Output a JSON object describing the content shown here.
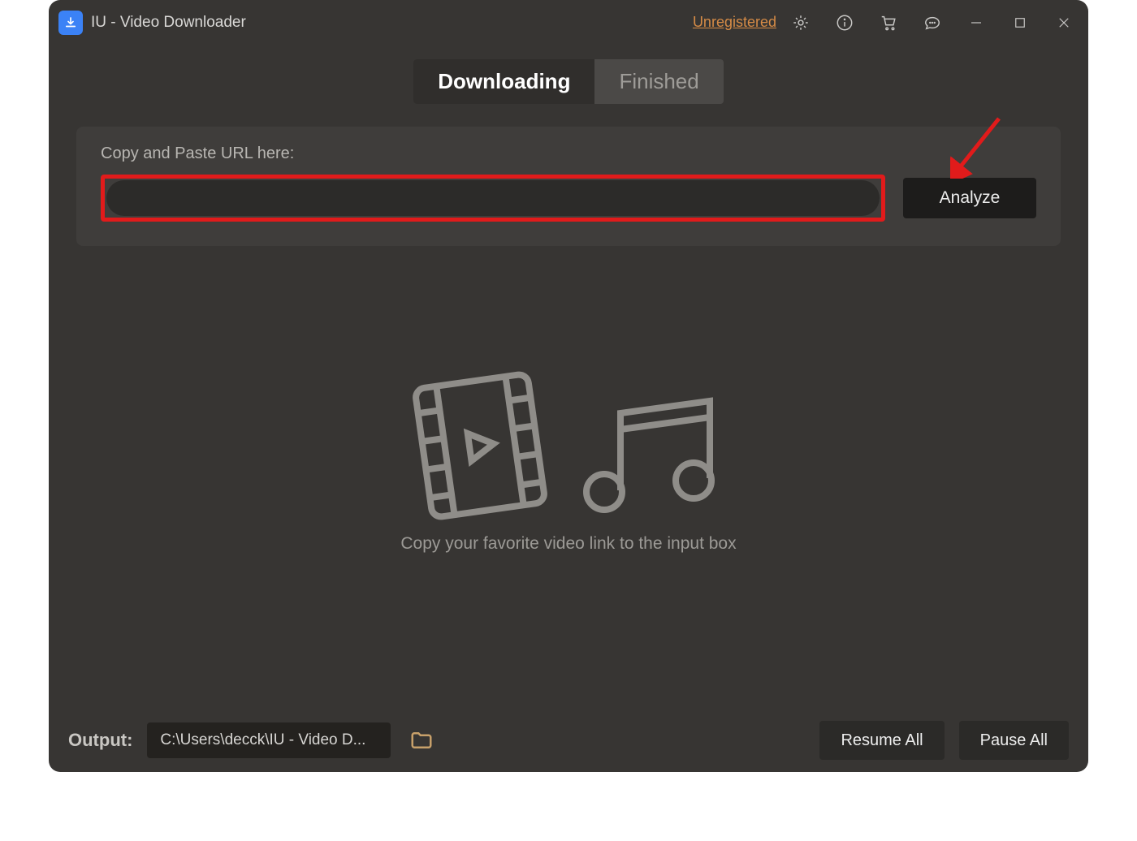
{
  "window": {
    "title": "IU - Video Downloader",
    "unregistered_label": "Unregistered"
  },
  "tabs": {
    "downloading": "Downloading",
    "finished": "Finished",
    "active": "downloading"
  },
  "url_panel": {
    "label": "Copy and Paste URL here:",
    "input_value": "",
    "placeholder": "",
    "analyze_label": "Analyze"
  },
  "empty_state": {
    "text": "Copy your favorite video link to the input box"
  },
  "bottom": {
    "output_label": "Output:",
    "output_path": "C:\\Users\\decck\\IU - Video D...",
    "resume_label": "Resume All",
    "pause_label": "Pause All"
  },
  "icons": {
    "app": "download-app-icon",
    "settings": "gear-icon",
    "info": "info-icon",
    "cart": "cart-icon",
    "feedback": "speech-bubble-icon",
    "minimize": "minimize-icon",
    "maximize": "maximize-icon",
    "close": "close-icon",
    "folder": "folder-icon",
    "film": "film-reel-icon",
    "music": "music-note-icon"
  },
  "colors": {
    "bg": "#373533",
    "panel": "#3f3d3b",
    "highlight": "#e11b1b",
    "accent_link": "#d58b46"
  }
}
